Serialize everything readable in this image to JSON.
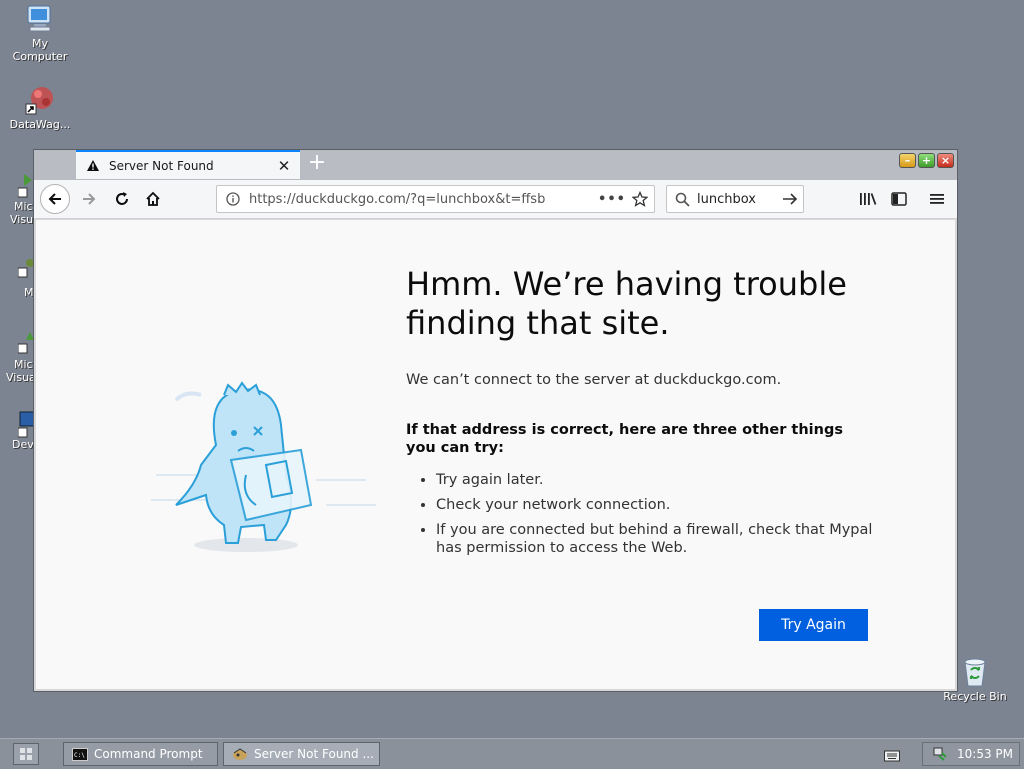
{
  "desktop": {
    "icons": [
      {
        "label_line1": "My",
        "label_line2": "Computer"
      },
      {
        "label": "DataWag..."
      },
      {
        "label": "Recycle Bin"
      }
    ],
    "partial_icons": [
      {
        "line1": "Mic",
        "line2": "Visu"
      },
      {
        "line1": "M"
      },
      {
        "line1": "Mic",
        "line2": "Visua"
      },
      {
        "line1": "Dev"
      }
    ]
  },
  "browser": {
    "tab_title": "Server Not Found",
    "tab_close": "✕",
    "new_tab": "+",
    "url": "https://duckduckgo.com/?q=lunchbox&t=ffsb",
    "url_more": "•••",
    "search_value": "lunchbox",
    "error": {
      "title": "Hmm. We’re having trouble finding that site.",
      "description": "We can’t connect to the server at duckduckgo.com.",
      "strong": "If that address is correct, here are three other things you can try:",
      "items": [
        "Try again later.",
        "Check your network connection.",
        "If you are connected but behind a firewall, check that Mypal has permission to access the Web."
      ],
      "button": "Try Again"
    },
    "colors": {
      "accent": "#0060df",
      "tab_highlight": "#0a84ff"
    }
  },
  "taskbar": {
    "tasks": [
      {
        "label": "Command Prompt",
        "icon": "cmd-icon"
      },
      {
        "label": "Server Not Found ...",
        "icon": "browser-icon"
      }
    ],
    "clock": "10:53 PM"
  }
}
